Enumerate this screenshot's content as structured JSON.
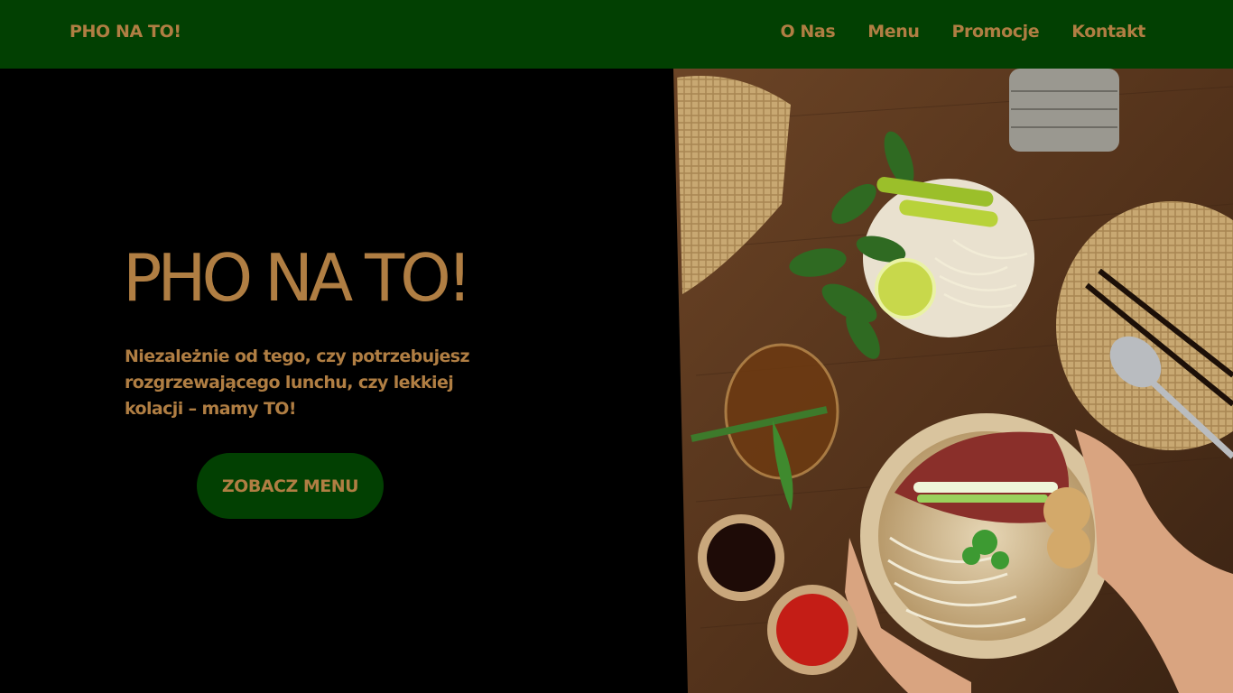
{
  "header": {
    "brand": "PHO NA TO!",
    "nav": [
      {
        "label": "O Nas"
      },
      {
        "label": "Menu"
      },
      {
        "label": "Promocje"
      },
      {
        "label": "Kontakt"
      }
    ]
  },
  "hero": {
    "title": "PHO NA TO!",
    "text": "Niezależnie od tego, czy potrzebujesz rozgrzewającego lunchu, czy lekkiej kolacji – mamy TO!",
    "cta_label": "ZOBACZ MENU"
  },
  "colors": {
    "header_bg": "#024002",
    "accent_gold": "#b07e43",
    "page_bg": "#000000",
    "button_bg": "#024002"
  }
}
